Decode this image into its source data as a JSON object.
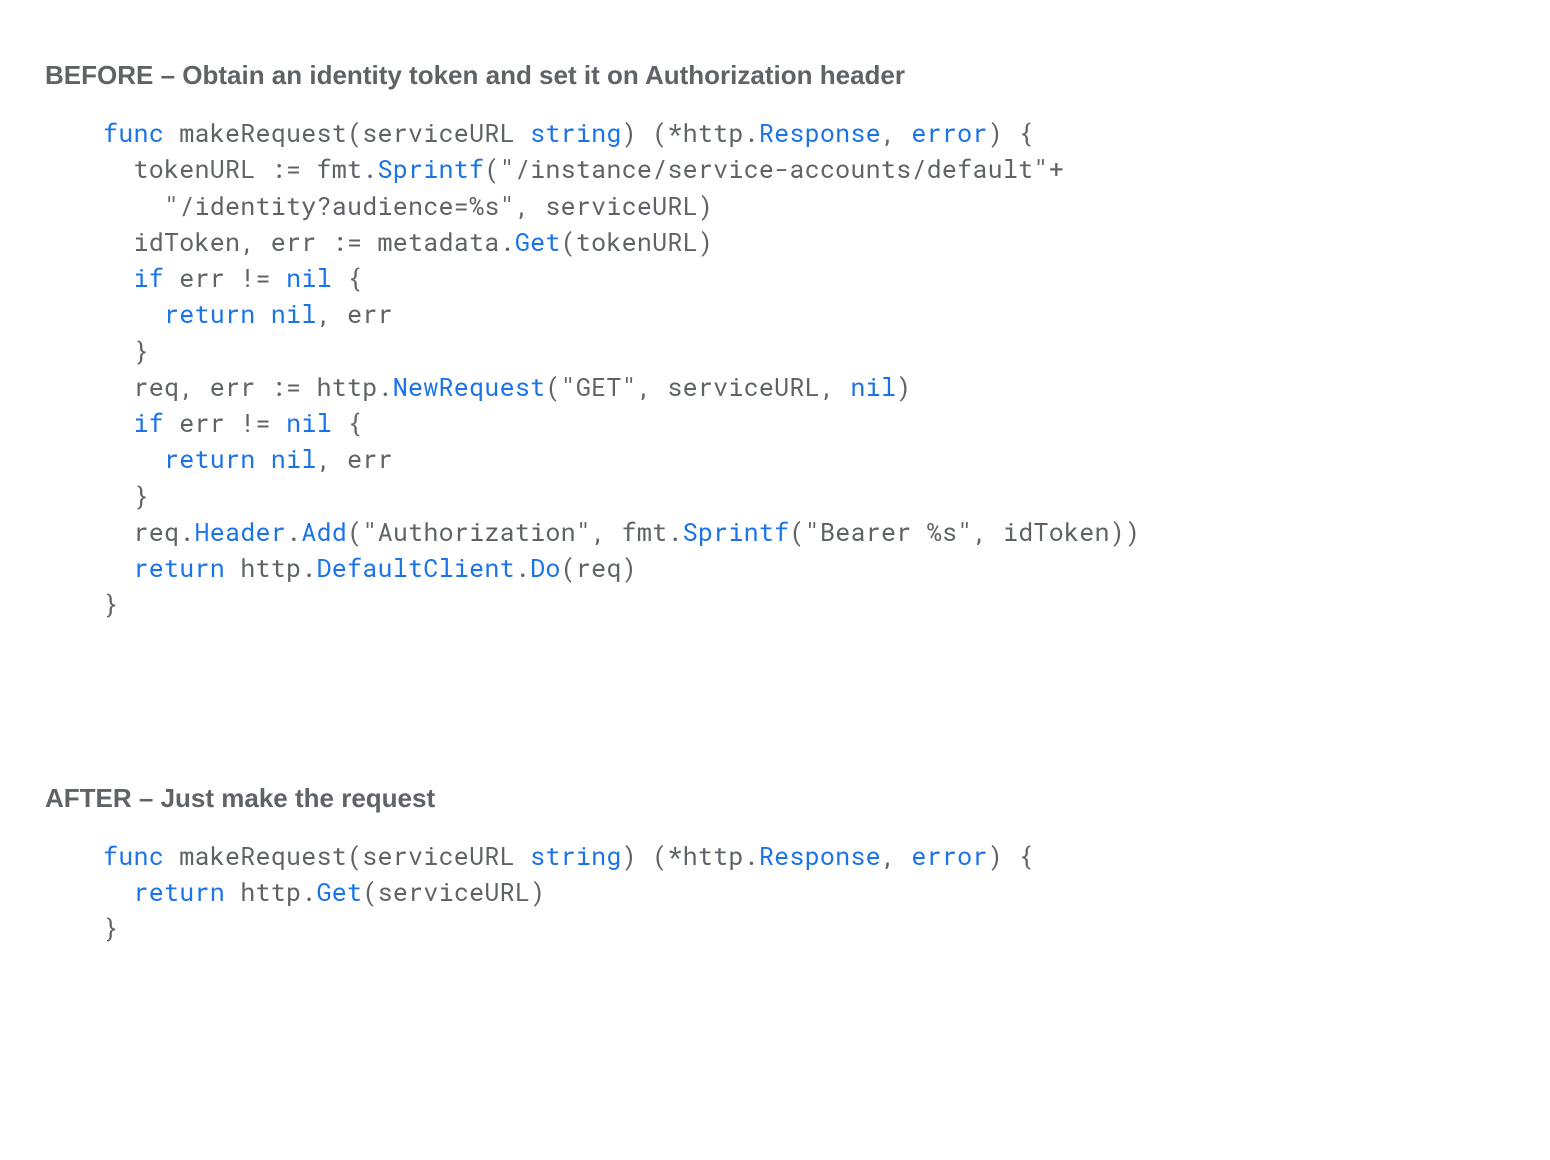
{
  "before": {
    "heading": "BEFORE – Obtain an identity token and set it on Authorization header",
    "code": {
      "l1": {
        "a": "func",
        "b": " makeRequest(serviceURL ",
        "c": "string",
        "d": ") (*http.",
        "e": "Response",
        "f": ", ",
        "g": "error",
        "h": ") {"
      },
      "l2": {
        "a": "  tokenURL := fmt.",
        "b": "Sprintf",
        "c": "(",
        "d": "\"/instance/service-accounts/default\"",
        "e": "+"
      },
      "l3": {
        "a": "    ",
        "b": "\"/identity?audience=%s\"",
        "c": ", serviceURL)"
      },
      "l4": {
        "a": "  idToken, err := metadata.",
        "b": "Get",
        "c": "(tokenURL)"
      },
      "l5": {
        "a": "  ",
        "b": "if",
        "c": " err != ",
        "d": "nil",
        "e": " {"
      },
      "l6": {
        "a": "    ",
        "b": "return",
        "c": " ",
        "d": "nil",
        "e": ", err"
      },
      "l7": {
        "a": "  }"
      },
      "l8": {
        "a": "  req, err := http.",
        "b": "NewRequest",
        "c": "(",
        "d": "\"GET\"",
        "e": ", serviceURL, ",
        "f": "nil",
        "g": ")"
      },
      "l9": {
        "a": "  ",
        "b": "if",
        "c": " err != ",
        "d": "nil",
        "e": " {"
      },
      "l10": {
        "a": "    ",
        "b": "return",
        "c": " ",
        "d": "nil",
        "e": ", err"
      },
      "l11": {
        "a": "  }"
      },
      "l12": {
        "a": "  req.",
        "b": "Header",
        "c": ".",
        "d": "Add",
        "e": "(",
        "f": "\"Authorization\"",
        "g": ", fmt.",
        "h": "Sprintf",
        "i": "(",
        "j": "\"Bearer %s\"",
        "k": ", idToken))"
      },
      "l13": {
        "a": "  ",
        "b": "return",
        "c": " http.",
        "d": "DefaultClient",
        "e": ".",
        "f": "Do",
        "g": "(req)"
      },
      "l14": {
        "a": "}"
      }
    }
  },
  "after": {
    "heading": "AFTER – Just make the request",
    "code": {
      "l1": {
        "a": "func",
        "b": " makeRequest(serviceURL ",
        "c": "string",
        "d": ") (*http.",
        "e": "Response",
        "f": ", ",
        "g": "error",
        "h": ") {"
      },
      "l2": {
        "a": "  ",
        "b": "return",
        "c": " http.",
        "d": "Get",
        "e": "(serviceURL)"
      },
      "l3": {
        "a": "}"
      }
    }
  }
}
